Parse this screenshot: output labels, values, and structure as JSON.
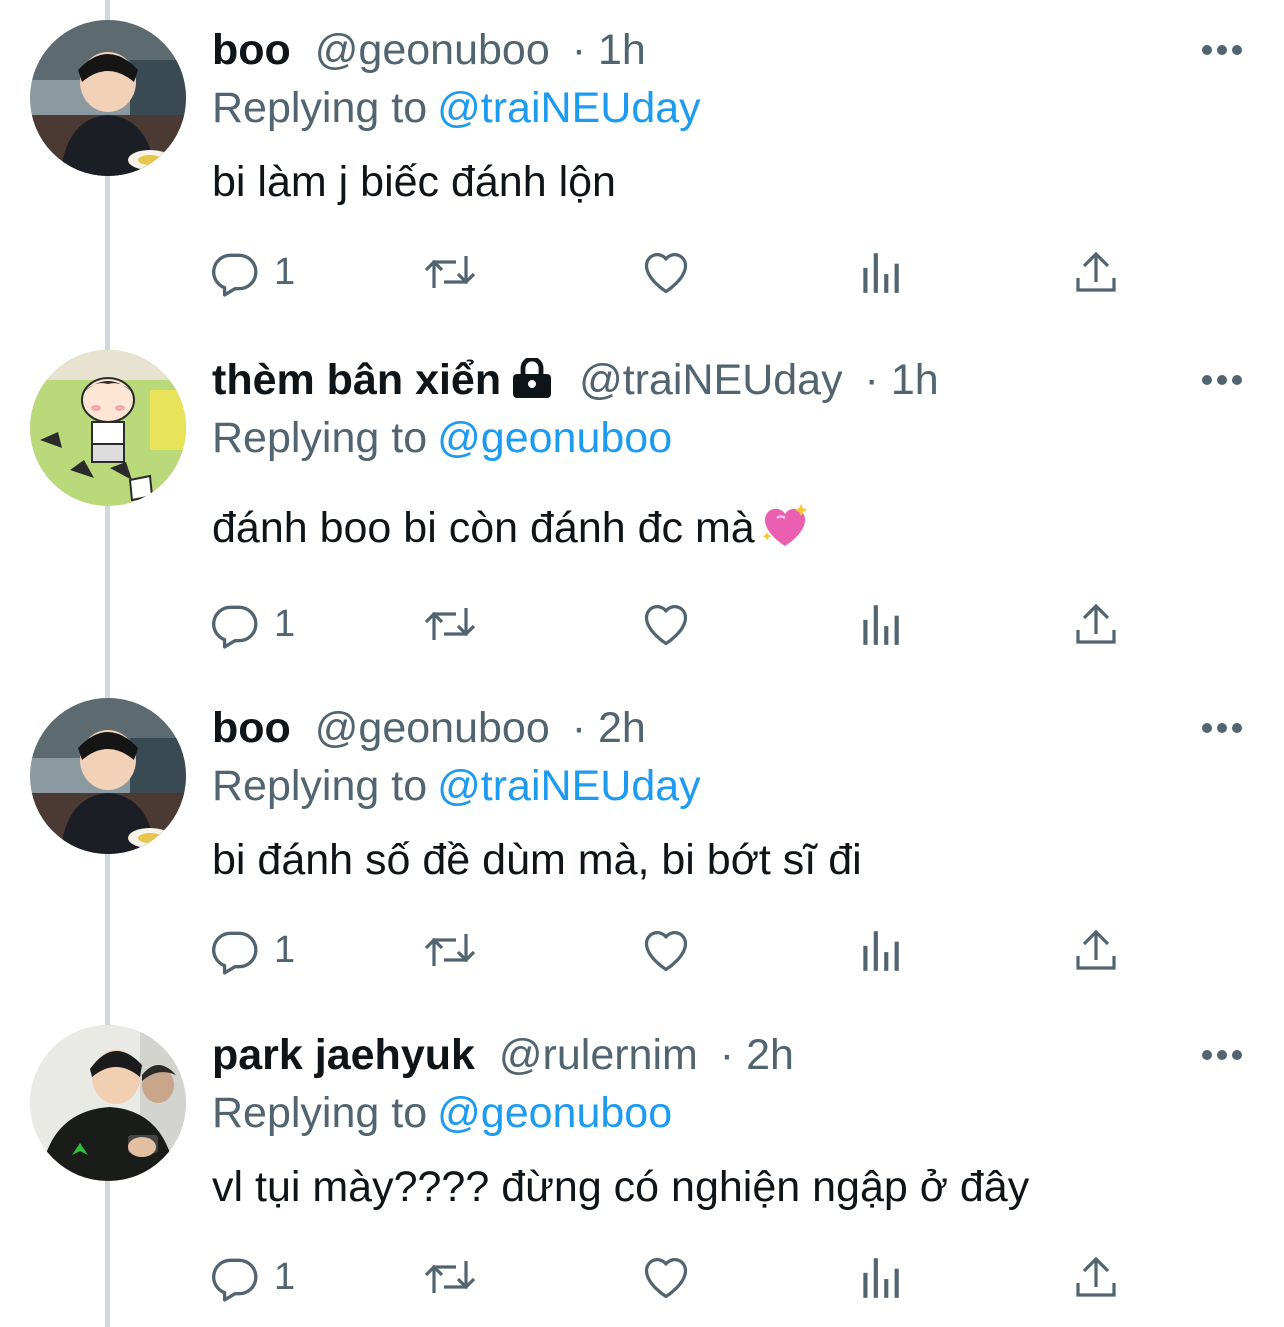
{
  "tweets": [
    {
      "name": "boo",
      "handle": "@geonuboo",
      "time": "· 1h",
      "replying_label": "Replying to",
      "replying_to": "@traiNEUday",
      "text": "bi làm j biếc đánh lộn",
      "reply_count": "1",
      "avatar_icon": "boy-eating-avatar",
      "locked": false
    },
    {
      "name": "thèm bân xiển",
      "handle": "@traiNEUday",
      "time": "· 1h",
      "replying_label": "Replying to",
      "replying_to": "@geonuboo",
      "text": "đánh boo bi còn đánh đc mà",
      "reply_count": "1",
      "avatar_icon": "cartoon-boy-avatar",
      "locked": true,
      "emoji": "sparkling-heart-emoji"
    },
    {
      "name": "boo",
      "handle": "@geonuboo",
      "time": "· 2h",
      "replying_label": "Replying to",
      "replying_to": "@traiNEUday",
      "text": "bi đánh số đề dùm mà, bi bớt sĩ đi",
      "reply_count": "1",
      "avatar_icon": "boy-eating-avatar",
      "locked": false
    },
    {
      "name": "park jaehyuk",
      "handle": "@rulernim",
      "time": "· 2h",
      "replying_label": "Replying to",
      "replying_to": "@geonuboo",
      "text": "vl tụi mày???? đừng có nghiện ngập ở đây",
      "reply_count": "1",
      "avatar_icon": "boy-with-phone-avatar",
      "locked": false
    }
  ],
  "colors": {
    "link": "#1d9bf0",
    "secondary_text": "#536471",
    "primary_text": "#0f1419",
    "thread_line": "#cfd9de"
  },
  "icons": [
    "reply-icon",
    "retweet-icon",
    "like-icon",
    "analytics-icon",
    "share-icon",
    "more-icon",
    "lock-icon"
  ]
}
